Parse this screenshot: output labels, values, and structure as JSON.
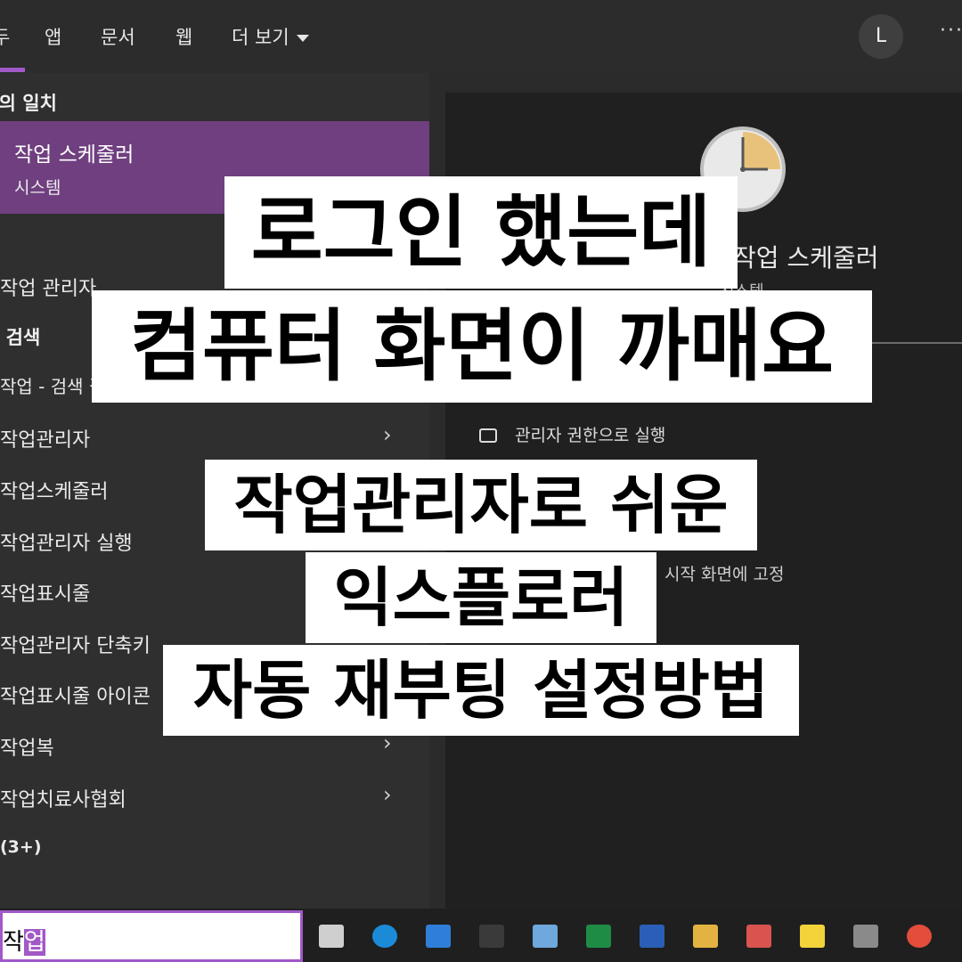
{
  "tabs": [
    {
      "label": "두"
    },
    {
      "label": "앱"
    },
    {
      "label": "문서"
    },
    {
      "label": "웹"
    },
    {
      "label": "더 보기"
    }
  ],
  "user_initial": "L",
  "more_label": "···",
  "best_match": {
    "section_label": "최고의 일치",
    "title": "작업 스케줄러",
    "subtitle": "시스템"
  },
  "apps_section_items": [
    {
      "label": "작업 관리자"
    }
  ],
  "web_section_label": "웹 검색",
  "results": [
    {
      "label": "작업 - 검색 결과 보기"
    },
    {
      "label": "작업관리자"
    },
    {
      "label": "작업스케줄러"
    },
    {
      "label": "작업관리자 실행"
    },
    {
      "label": "작업표시줄"
    },
    {
      "label": "작업관리자 단축키"
    },
    {
      "label": "작업표시줄 아이콘"
    },
    {
      "label": "작업복"
    },
    {
      "label": "작업치료사협회"
    }
  ],
  "more_count": "(3+)",
  "detail": {
    "title": "작업 스케줄러",
    "subtitle": "시스템",
    "action_run_admin": "관리자 권한으로 실행",
    "action_pin": "시작 화면에 고정"
  },
  "headline": {
    "line1": "로그인 했는데",
    "line2": "컴퓨터 화면이 까매요",
    "line3": "작업관리자로 쉬운",
    "line4": "익스플로러",
    "line5": "자동 재부팅 설정방법"
  },
  "search": {
    "typed": "작",
    "selected": "업"
  },
  "colors": {
    "accent": "#a259c7",
    "best_match_bg": "#6f3f7f",
    "panel_bg": "#2f2f2f",
    "detail_bg": "#202020",
    "taskbar_bg": "#1f1f1f"
  },
  "taskbar_icons": [
    "task-view-icon",
    "edge-icon",
    "outlook-icon",
    "media-icon",
    "notepad-icon",
    "excel-icon",
    "word-icon",
    "file-explorer-icon",
    "paint-icon",
    "sticky-notes-icon",
    "calculator-icon",
    "chrome-icon"
  ]
}
